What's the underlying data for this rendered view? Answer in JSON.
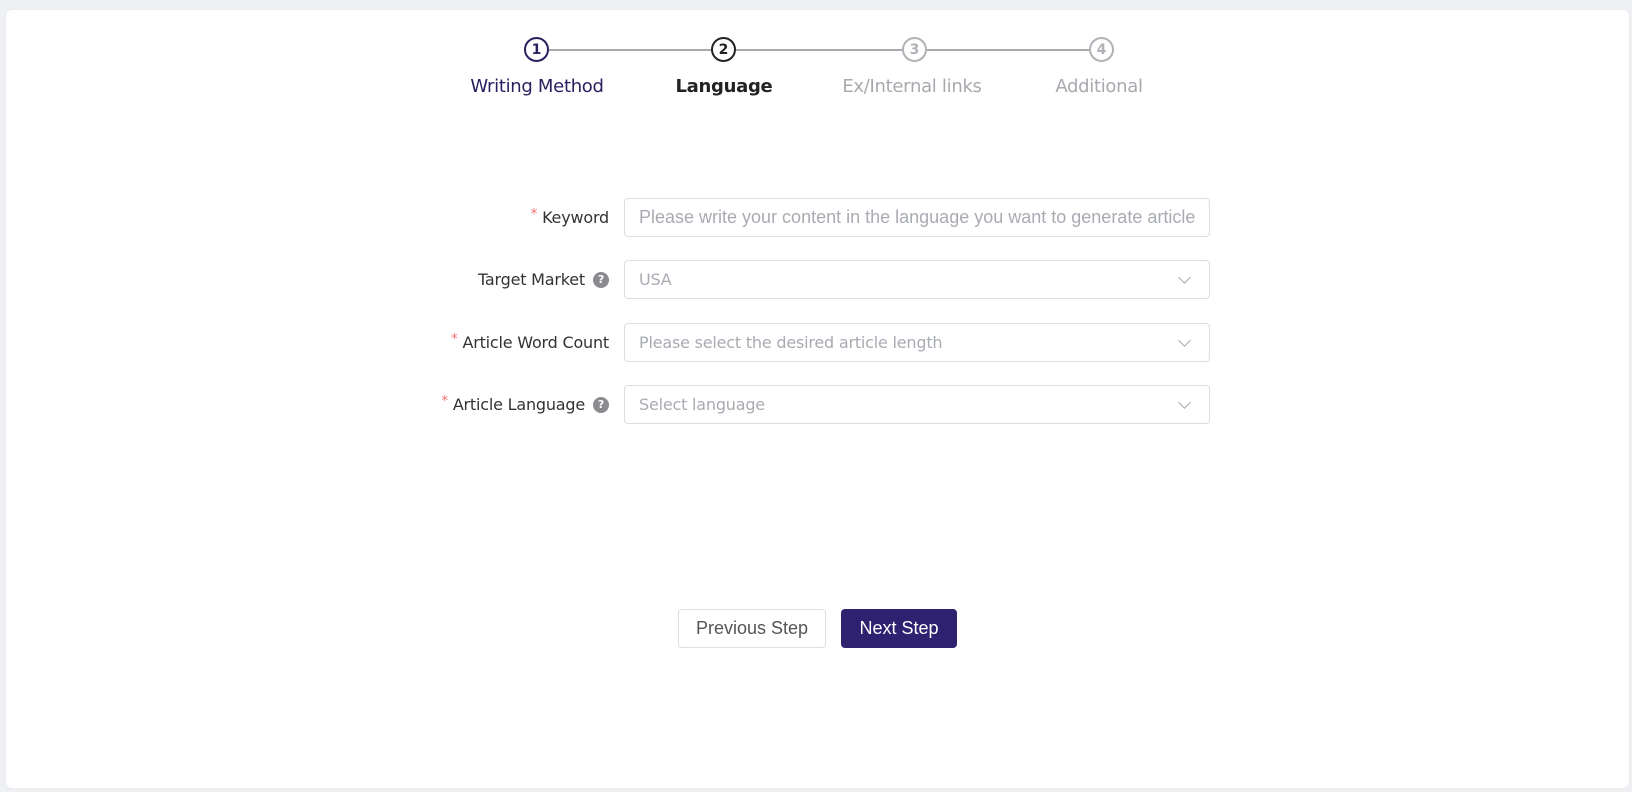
{
  "steps": [
    {
      "number": "1",
      "label": "Writing Method",
      "state": "done"
    },
    {
      "number": "2",
      "label": "Language",
      "state": "active"
    },
    {
      "number": "3",
      "label": "Ex/Internal links",
      "state": "pending"
    },
    {
      "number": "4",
      "label": "Additional",
      "state": "pending"
    }
  ],
  "form": {
    "keyword": {
      "label": "Keyword",
      "required": true,
      "placeholder": "Please write your content in the language you want to generate articles f",
      "value": ""
    },
    "target_market": {
      "label": "Target Market",
      "required": false,
      "value": "USA",
      "help_icon": "question-circle-icon"
    },
    "word_count": {
      "label": "Article Word Count",
      "required": true,
      "placeholder": "Please select the desired article length"
    },
    "language": {
      "label": "Article Language",
      "required": true,
      "placeholder": "Select language",
      "help_icon": "question-circle-icon"
    },
    "required_mark": "*",
    "help_glyph": "?"
  },
  "buttons": {
    "previous": "Previous Step",
    "next": "Next Step"
  },
  "colors": {
    "primary": "#2e2170",
    "required": "#f56c6c",
    "inactive": "#a7a9ae"
  }
}
